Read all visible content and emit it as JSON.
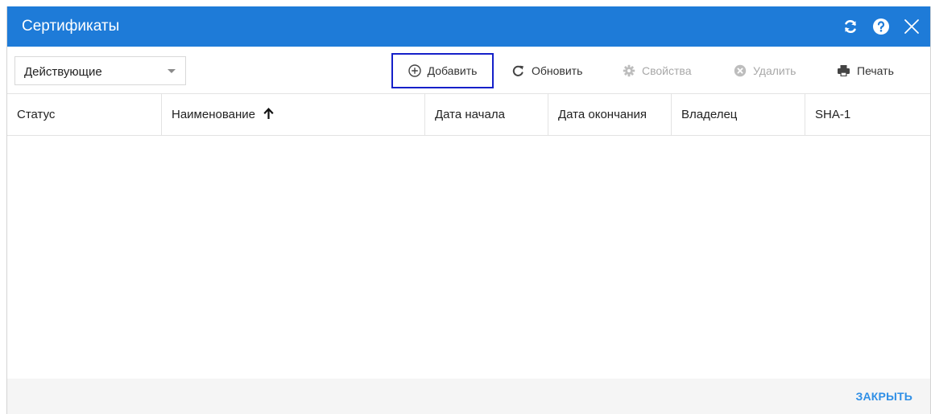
{
  "window": {
    "title": "Сертификаты",
    "accent_color": "#1e7bd8",
    "title_icons": [
      "refresh-icon",
      "help-icon",
      "close-icon"
    ]
  },
  "toolbar": {
    "filter": {
      "value": "Действующие"
    },
    "buttons": {
      "add": {
        "label": "Добавить",
        "icon": "plus-circle-icon",
        "enabled": true
      },
      "refresh": {
        "label": "Обновить",
        "icon": "refresh-icon",
        "enabled": true
      },
      "properties": {
        "label": "Свойства",
        "icon": "gear-icon",
        "enabled": false
      },
      "delete": {
        "label": "Удалить",
        "icon": "x-circle-icon",
        "enabled": false
      },
      "print": {
        "label": "Печать",
        "icon": "printer-icon",
        "enabled": true
      }
    }
  },
  "table": {
    "columns": [
      {
        "label": "Статус"
      },
      {
        "label": "Наименование",
        "sort": "ascending"
      },
      {
        "label": "Дата начала"
      },
      {
        "label": "Дата окончания"
      },
      {
        "label": "Владелец"
      },
      {
        "label": "SHA-1"
      }
    ],
    "rows": []
  },
  "footer": {
    "close_label": "ЗАКРЫТЬ"
  }
}
